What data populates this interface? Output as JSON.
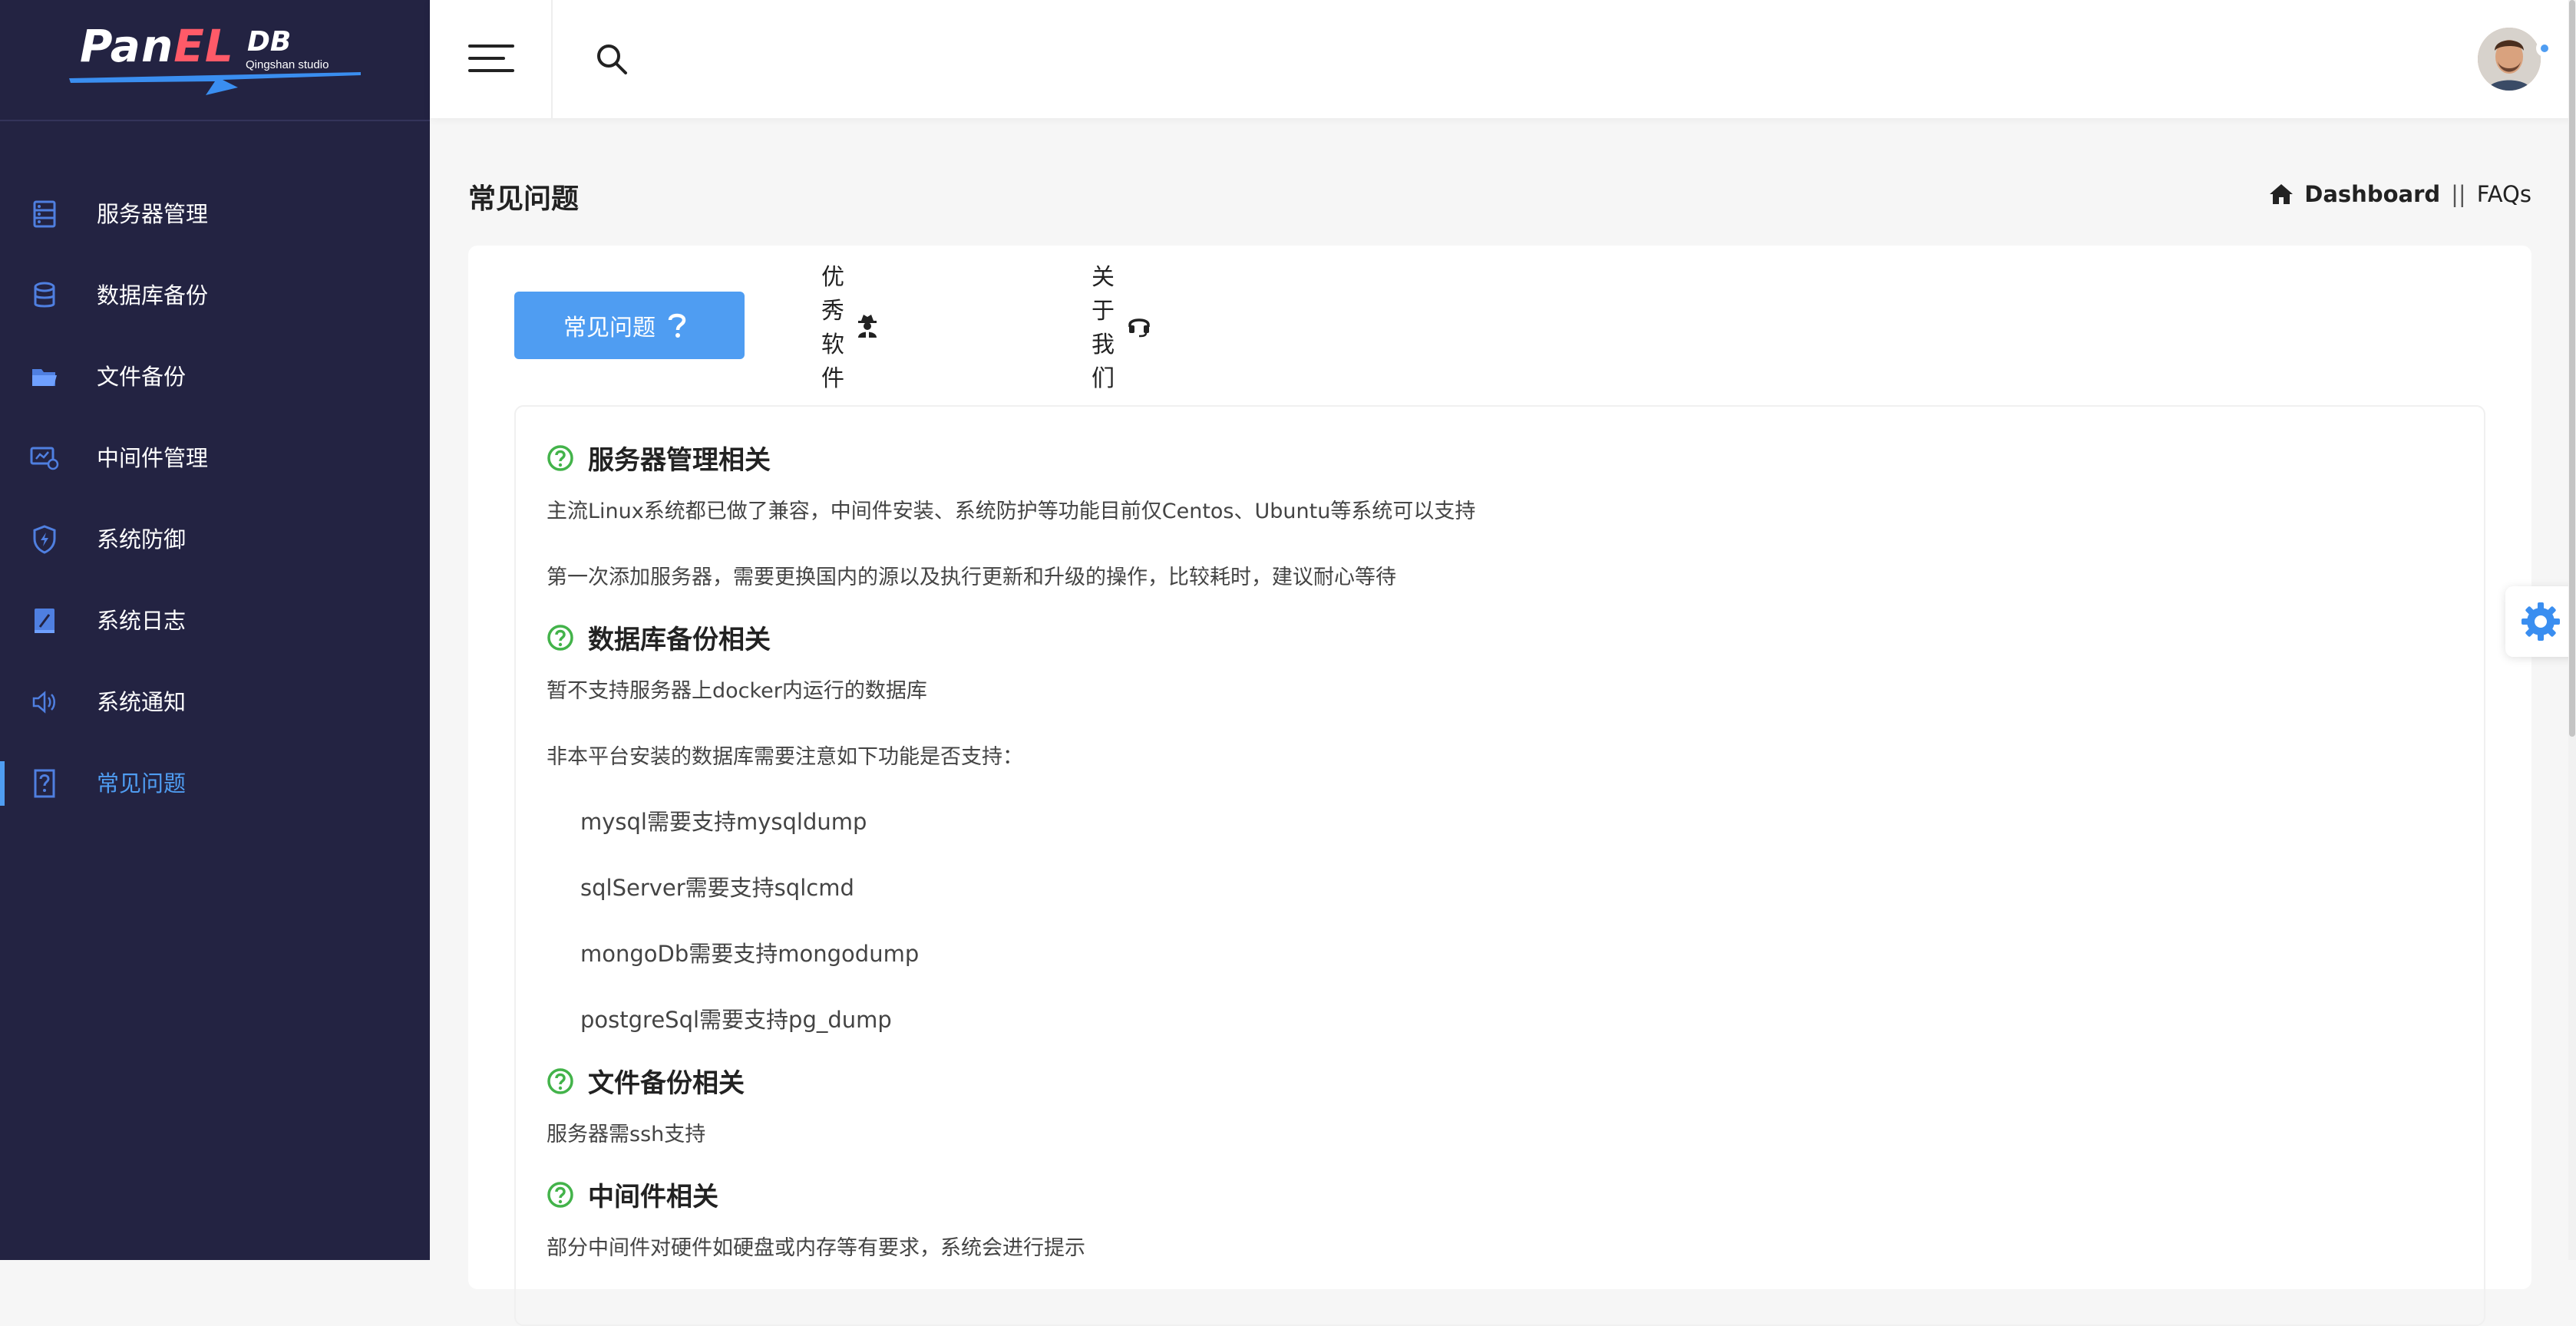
{
  "brand": {
    "logo_main_1": "Pan",
    "logo_main_2": "EL",
    "logo_db": "DB",
    "logo_sub": "Qingshan studio"
  },
  "sidebar": {
    "items": [
      {
        "label": "服务器管理",
        "icon": "server-icon"
      },
      {
        "label": "数据库备份",
        "icon": "database-icon"
      },
      {
        "label": "文件备份",
        "icon": "folder-icon"
      },
      {
        "label": "中间件管理",
        "icon": "middleware-icon"
      },
      {
        "label": "系统防御",
        "icon": "shield-icon"
      },
      {
        "label": "系统日志",
        "icon": "log-icon"
      },
      {
        "label": "系统通知",
        "icon": "speaker-icon"
      },
      {
        "label": "常见问题",
        "icon": "faq-icon",
        "active": true
      }
    ]
  },
  "page": {
    "title": "常见问题",
    "breadcrumb": {
      "home": "Dashboard",
      "separator": "||",
      "current": "FAQs"
    }
  },
  "tabs": [
    {
      "label": "常见问题",
      "icon": "question-icon",
      "active": true
    },
    {
      "label": "优秀软件",
      "icon": "user-secret-icon"
    },
    {
      "label": "关于我们",
      "icon": "headset-icon"
    }
  ],
  "faq": {
    "s1_title": "服务器管理相关",
    "s1_l1": "主流Linux系统都已做了兼容，中间件安装、系统防护等功能目前仅Centos、Ubuntu等系统可以支持",
    "s1_l2": "第一次添加服务器，需要更换国内的源以及执行更新和升级的操作，比较耗时，建议耐心等待",
    "s2_title": "数据库备份相关",
    "s2_l1": "暂不支持服务器上docker内运行的数据库",
    "s2_l2": "非本平台安装的数据库需要注意如下功能是否支持：",
    "s2_i1": "mysql需要支持mysqldump",
    "s2_i2": "sqlServer需要支持sqlcmd",
    "s2_i3": "mongoDb需要支持mongodump",
    "s2_i4": "postgreSql需要支持pg_dump",
    "s3_title": "文件备份相关",
    "s3_l1": "服务器需ssh支持",
    "s4_title": "中间件相关",
    "s4_l1": "部分中间件对硬件如硬盘或内存等有要求，系统会进行提示"
  },
  "colors": {
    "sidebar_bg": "#232342",
    "accent": "#4f9df2",
    "faq_icon": "#43b34a"
  }
}
